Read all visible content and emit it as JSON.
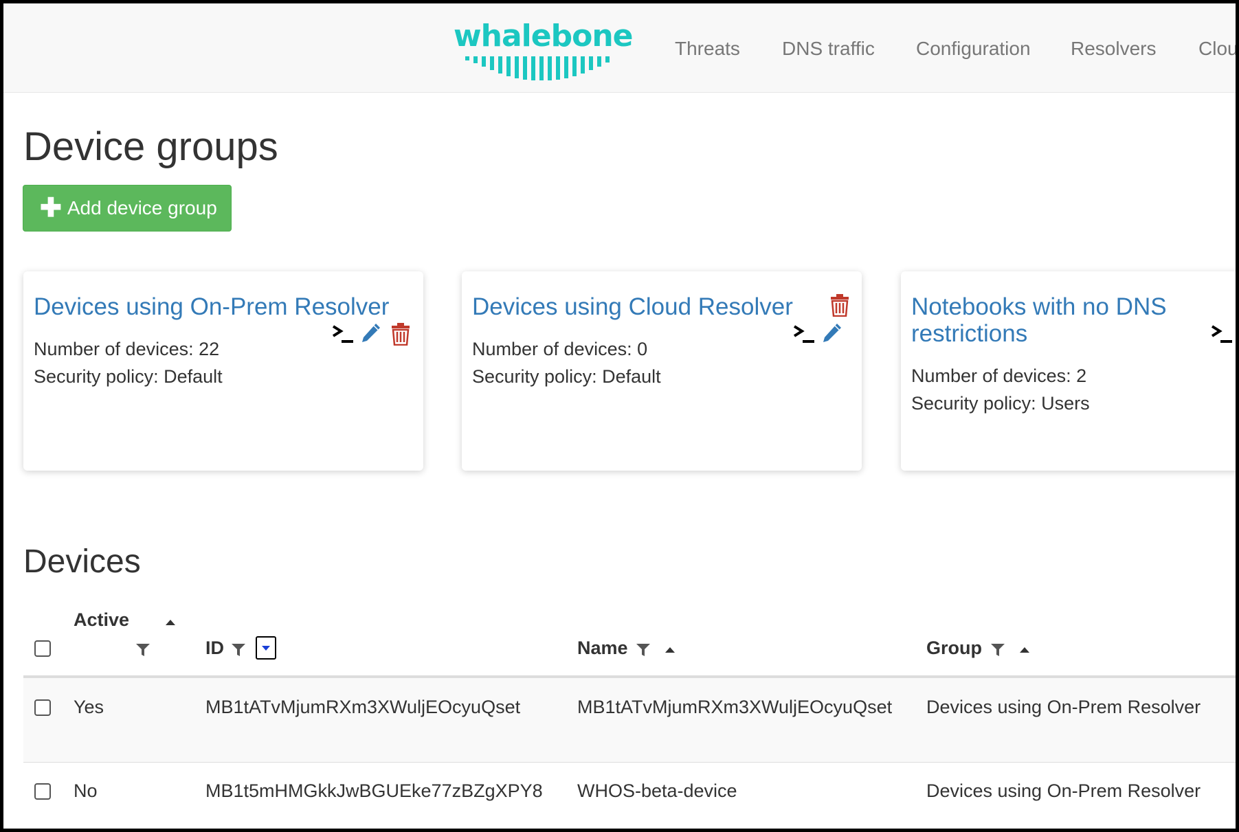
{
  "navbar": {
    "logo_text": "whalebone",
    "items": [
      "Threats",
      "DNS traffic",
      "Configuration",
      "Resolvers",
      "Clou"
    ]
  },
  "page_title": "Device groups",
  "add_button_label": "Add device group",
  "groups": [
    {
      "title": "Devices using On-Prem Resolver",
      "devices_line": "Number of devices: 22",
      "policy_line": "Security policy: Default"
    },
    {
      "title": "Devices using Cloud Resolver",
      "devices_line": "Number of devices: 0",
      "policy_line": "Security policy: Default"
    },
    {
      "title": "Notebooks with no DNS restrictions",
      "devices_line": "Number of devices: 2",
      "policy_line": "Security policy: Users"
    }
  ],
  "devices_title": "Devices",
  "table": {
    "columns": {
      "active": "Active",
      "id": "ID",
      "name": "Name",
      "group": "Group"
    },
    "rows": [
      {
        "active": "Yes",
        "id": "MB1tATvMjumRXm3XWuljEOcyuQset",
        "name": "MB1tATvMjumRXm3XWuljEOcyuQset",
        "group": "Devices using On-Prem Resolver"
      },
      {
        "active": "No",
        "id": "MB1t5mHMGkkJwBGUEke77zBZgXPY8",
        "name": "WHOS-beta-device",
        "group": "Devices using On-Prem Resolver"
      }
    ]
  },
  "icons": {
    "terminal": "terminal-icon",
    "edit": "pencil-icon",
    "delete": "trash-icon",
    "filter": "filter-icon",
    "sort": "sort-asc-icon",
    "add": "plus-icon"
  },
  "colors": {
    "brand": "#1cc7c1",
    "link": "#337ab7",
    "success": "#5cb85c",
    "danger": "#c0392b",
    "navbar_bg": "#f8f8f8",
    "row_alt_bg": "#f9f9f9"
  }
}
